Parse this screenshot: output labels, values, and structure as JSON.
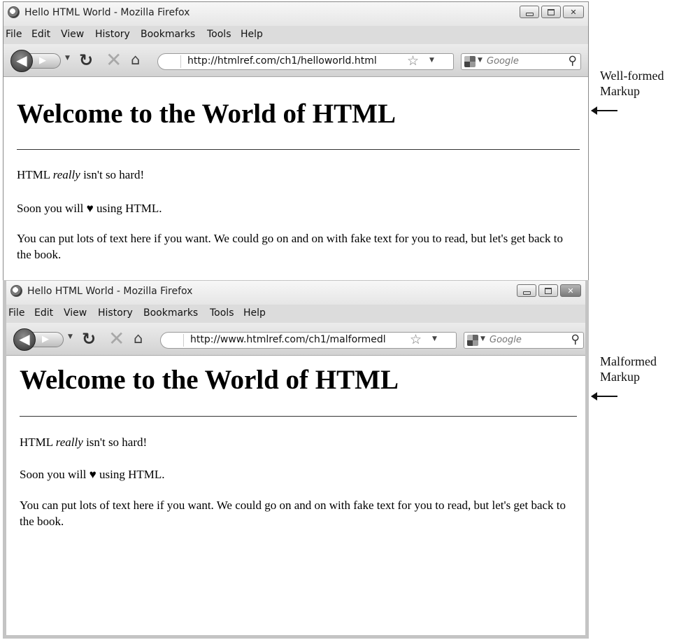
{
  "windows": [
    {
      "title": "Hello HTML World - Mozilla Firefox",
      "menu": [
        "File",
        "Edit",
        "View",
        "History",
        "Bookmarks",
        "Tools",
        "Help"
      ],
      "url": "http://htmlref.com/ch1/helloworld.html",
      "search_placeholder": "Google",
      "page": {
        "heading": "Welcome to the World of HTML",
        "p1_before": "HTML ",
        "p1_em": "really",
        "p1_after": " isn't so hard!",
        "p2": "Soon you will ♥ using HTML.",
        "p3": "You can put lots of text here if you want. We could go on and on with fake text for you to read, but let's get back to the book."
      },
      "side_label": [
        "Well-formed",
        "Markup"
      ]
    },
    {
      "title": "Hello HTML World - Mozilla Firefox",
      "menu": [
        "File",
        "Edit",
        "View",
        "History",
        "Bookmarks",
        "Tools",
        "Help"
      ],
      "url": "http://www.htmlref.com/ch1/malformedl",
      "search_placeholder": "Google",
      "page": {
        "heading": "Welcome to the World of HTML",
        "p1_before": "HTML ",
        "p1_em": "really",
        "p1_after": " isn't so hard!",
        "p2": "Soon you will ♥ using HTML.",
        "p3": "You can put lots of text here if you want. We could go on and on with fake text for you to read, but let's get back to the book."
      },
      "side_label": [
        "Malformed",
        "Markup"
      ]
    }
  ],
  "icons": {
    "back": "back-arrow-icon",
    "forward": "forward-arrow-icon",
    "reload": "reload-icon",
    "stop": "stop-icon",
    "home": "home-icon",
    "bookmark": "star-icon",
    "search": "magnifier-icon"
  }
}
